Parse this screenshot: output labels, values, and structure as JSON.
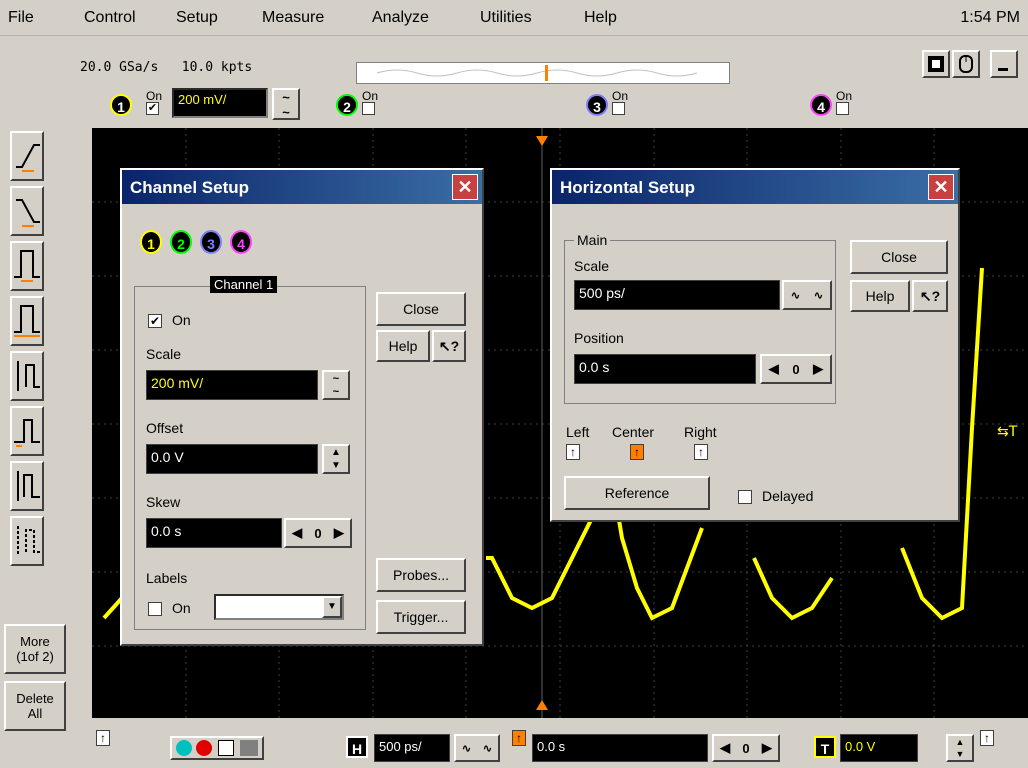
{
  "menu": {
    "items": [
      "File",
      "Control",
      "Setup",
      "Measure",
      "Analyze",
      "Utilities",
      "Help"
    ],
    "clock": "1:54 PM"
  },
  "status": {
    "sample_rate": "20.0 GSa/s",
    "memory": "10.0 kpts"
  },
  "channels": [
    {
      "num": "1",
      "on_label": "On",
      "checked": true,
      "scale": "200 mV/",
      "color": "#ffff00"
    },
    {
      "num": "2",
      "on_label": "On",
      "checked": false,
      "color": "#00ff00"
    },
    {
      "num": "3",
      "on_label": "On",
      "checked": false,
      "color": "#8080ff"
    },
    {
      "num": "4",
      "on_label": "On",
      "checked": false,
      "color": "#ff40ff"
    }
  ],
  "left_toolbar": {
    "more_label": "More\n(1of 2)",
    "delete_label": "Delete\nAll"
  },
  "channel_setup": {
    "title": "Channel Setup",
    "tooltip": "Channel 1",
    "on_label": "On",
    "scale_label": "Scale",
    "scale_value": "200 mV/",
    "offset_label": "Offset",
    "offset_value": "0.0 V",
    "skew_label": "Skew",
    "skew_value": "0.0 s",
    "labels_label": "Labels",
    "labels_on": "On",
    "close": "Close",
    "help": "Help",
    "probes": "Probes...",
    "trigger": "Trigger..."
  },
  "horizontal_setup": {
    "title": "Horizontal Setup",
    "group": "Main",
    "scale_label": "Scale",
    "scale_value": "500 ps/",
    "position_label": "Position",
    "position_value": "0.0 s",
    "left": "Left",
    "center": "Center",
    "right": "Right",
    "reference": "Reference",
    "delayed": "Delayed",
    "close": "Close",
    "help": "Help"
  },
  "bottom": {
    "h_label": "H",
    "h_scale": "500 ps/",
    "position": "0.0 s",
    "t_label": "T",
    "trigger_level": "0.0 V"
  },
  "colors": {
    "accent": "#ff8000",
    "trace": "#ffff00",
    "title_bar": "#0a246a"
  }
}
